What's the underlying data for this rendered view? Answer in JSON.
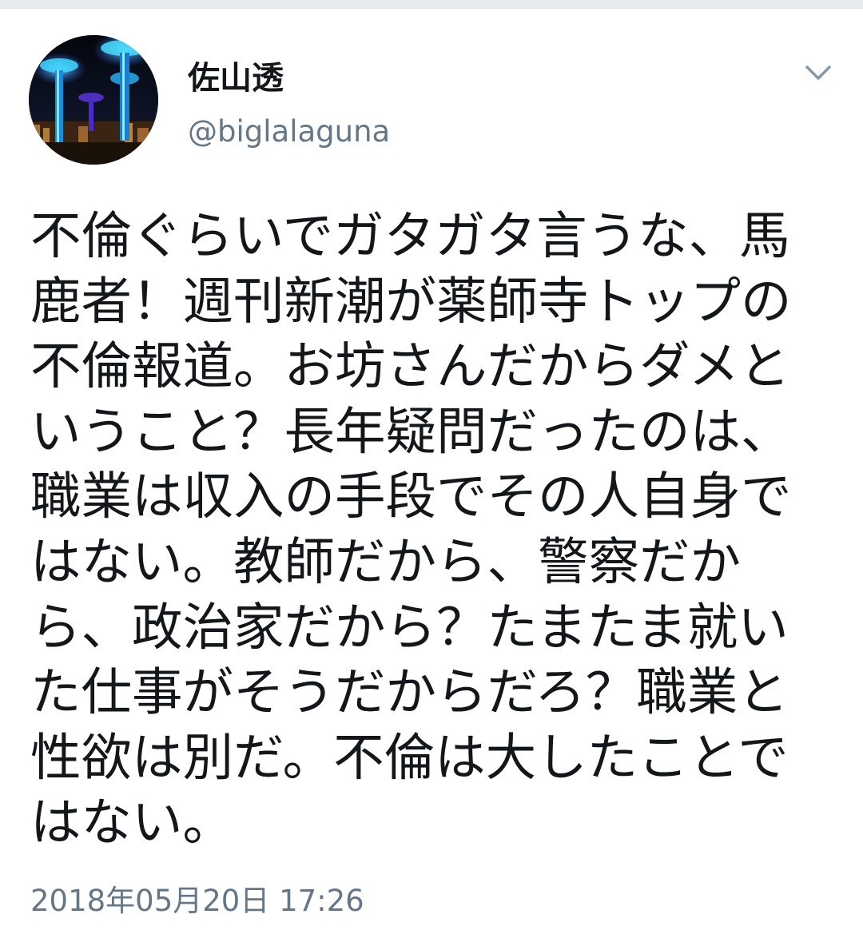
{
  "tweet": {
    "author": {
      "display_name": "佐山透",
      "handle": "@biglalaguna",
      "avatar_icon": "night-garden-towers-avatar"
    },
    "menu_icon": "chevron-down-icon",
    "text_lines": [
      "不倫ぐらいでガタガタ言うな、馬",
      "鹿者！週刊新潮が薬師寺トップの",
      "不倫報道。お坊さんだからダメと",
      "いうこと？長年疑問だったのは、",
      "職業は収入の手段でその人自身で",
      "はない。教師だから、警察だか",
      "ら、政治家だから？たまたま就い",
      "た仕事がそうだからだろ？職業と",
      "性欲は別だ。不倫は大したことで",
      "はない。"
    ],
    "timestamp": "2018年05月20日 17:26"
  },
  "colors": {
    "text_primary": "#14171a",
    "text_secondary": "#657786",
    "background": "#ffffff",
    "chevron": "#8899a6"
  }
}
